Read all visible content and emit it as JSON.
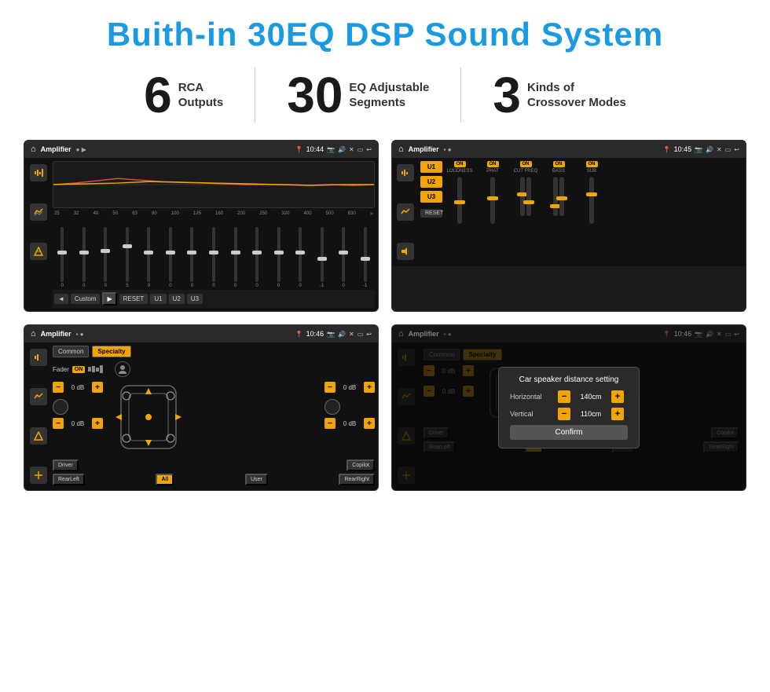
{
  "title": "Buith-in 30EQ DSP Sound System",
  "stats": [
    {
      "number": "6",
      "line1": "RCA",
      "line2": "Outputs"
    },
    {
      "number": "30",
      "line1": "EQ Adjustable",
      "line2": "Segments"
    },
    {
      "number": "3",
      "line1": "Kinds of",
      "line2": "Crossover Modes"
    }
  ],
  "screens": {
    "top_left": {
      "title": "Amplifier",
      "time": "10:44",
      "eq_labels": [
        "25",
        "32",
        "40",
        "50",
        "63",
        "80",
        "100",
        "125",
        "160",
        "200",
        "250",
        "320",
        "400",
        "500",
        "630"
      ],
      "eq_values": [
        "0",
        "0",
        "0",
        "5",
        "0",
        "0",
        "0",
        "0",
        "0",
        "0",
        "0",
        "0",
        "-1",
        "0",
        "-1"
      ],
      "eq_slider_positions": [
        50,
        45,
        42,
        35,
        40,
        48,
        50,
        52,
        55,
        50,
        50,
        48,
        60,
        50,
        58
      ],
      "buttons": [
        "Custom",
        "RESET",
        "U1",
        "U2",
        "U3"
      ]
    },
    "top_right": {
      "title": "Amplifier",
      "time": "10:45",
      "u_buttons": [
        "U1",
        "U2",
        "U3"
      ],
      "controls": [
        {
          "label": "LOUDNESS",
          "badge": "ON"
        },
        {
          "label": "PHAT",
          "badge": "ON"
        },
        {
          "label": "CUT FREQ",
          "badge": "ON"
        },
        {
          "label": "BASS",
          "badge": "ON"
        },
        {
          "label": "SUB",
          "badge": "ON"
        }
      ],
      "reset_label": "RESET"
    },
    "bottom_left": {
      "title": "Amplifier",
      "time": "10:46",
      "tabs": [
        "Common",
        "Specialty"
      ],
      "fader_label": "Fader",
      "fader_badge": "ON",
      "vol_groups": [
        {
          "val": "0 dB"
        },
        {
          "val": "0 dB"
        },
        {
          "val": "0 dB"
        },
        {
          "val": "0 dB"
        }
      ],
      "bottom_btns": [
        "Driver",
        "Copilot",
        "RearLeft",
        "All",
        "User",
        "RearRight"
      ]
    },
    "bottom_right": {
      "title": "Amplifier",
      "time": "10:46",
      "tabs": [
        "Common",
        "Specialty"
      ],
      "dialog": {
        "title": "Car speaker distance setting",
        "horizontal_label": "Horizontal",
        "horizontal_value": "140cm",
        "vertical_label": "Vertical",
        "vertical_value": "110cm",
        "confirm_label": "Confirm"
      },
      "bottom_btns": [
        "Driver",
        "Copilot",
        "RearLeft",
        "User",
        "RearRight"
      ],
      "vol_groups": [
        {
          "val": "0 dB"
        },
        {
          "val": "0 dB"
        }
      ]
    }
  },
  "icons": {
    "home": "⌂",
    "music": "♫",
    "location": "📍",
    "volume": "🔊",
    "back": "↩",
    "settings": "⚙",
    "minus": "−",
    "plus": "+"
  }
}
